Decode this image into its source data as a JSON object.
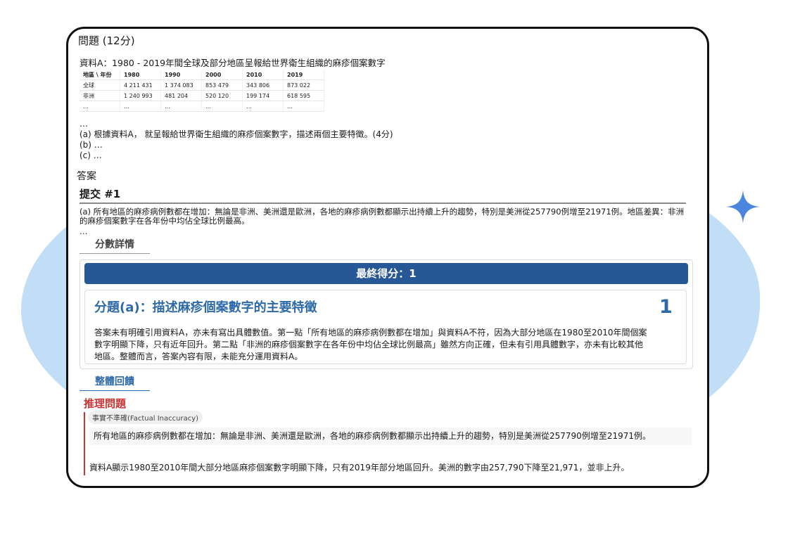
{
  "question": {
    "title": "問題 (12分)",
    "source_label": "資料A：1980 - 2019年間全球及部分地區呈報給世界衛生組織的麻疹個案數字",
    "table": {
      "headers": [
        "地區 \\ 年份",
        "1980",
        "1990",
        "2000",
        "2010",
        "2019"
      ],
      "rows": [
        [
          "全球",
          "4 211 431",
          "1 374 083",
          "853 479",
          "343 806",
          "873 022"
        ],
        [
          "非洲",
          "1 240 993",
          "481 204",
          "520 120",
          "199 174",
          "618 595"
        ],
        [
          "…",
          "…",
          "…",
          "…",
          "…",
          "…"
        ]
      ]
    },
    "ellipsis": "…",
    "part_a": "(a) 根據資料A， 就呈報給世界衛生組織的麻疹個案數字，描述兩個主要特徵。(4分)",
    "part_b": "(b) …",
    "part_c": "(c) …"
  },
  "answer": {
    "label": "答案",
    "submission_title": "提交 #1",
    "text": "(a) 所有地區的麻疹病例數都在增加：無論是非洲、美洲還是歐洲，各地的麻疹病例數都顯示出持續上升的趨勢，特別是美洲從257790例增至21971例。地區差異：非洲的麻疹個案數字在各年份中均佔全球比例最高。",
    "ellipsis": "…"
  },
  "score_details": {
    "tab_label": "分數詳情",
    "final_score_label": "最終得分：1",
    "part_title": "分題(a)：描述麻疹個案數字的主要特徵",
    "part_score": "1",
    "comment": "答案未有明確引用資料A，亦未有寫出具體數值。第一點「所有地區的麻疹病例數都在增加」與資料A不符，因為大部分地區在1980至2010年間個案數字明顯下降，只有近年回升。第二點「非洲的麻疹個案數字在各年份中均佔全球比例最高」雖然方向正確，但未有引用具體數字，亦未有比較其他地區。整體而言，答案內容有限，未能充分運用資料A。"
  },
  "feedback": {
    "tab_label": "整體回饋",
    "reasoning_title": "推理問題",
    "badge": "事實不準確(Factual Inaccuracy)",
    "quote": "所有地區的麻疹病例數都在增加：無論是非洲、美洲還是歐洲，各地的麻疹病例數都顯示出持續上升的趨勢，特別是美洲從257790例增至21971例。",
    "correction": "資料A顯示1980至2010年間大部分地區麻疹個案數字明顯下降，只有2019年部分地區回升。美洲的數字由257,790下降至21,971，並非上升。"
  },
  "colors": {
    "accent": "#275795",
    "heading_blue": "#2e6aa8",
    "error_red": "#cc3333",
    "blob": "#c2ddf6",
    "sparkle": "#4a86e0"
  },
  "icons": {
    "sparkle": "sparkle-icon"
  }
}
